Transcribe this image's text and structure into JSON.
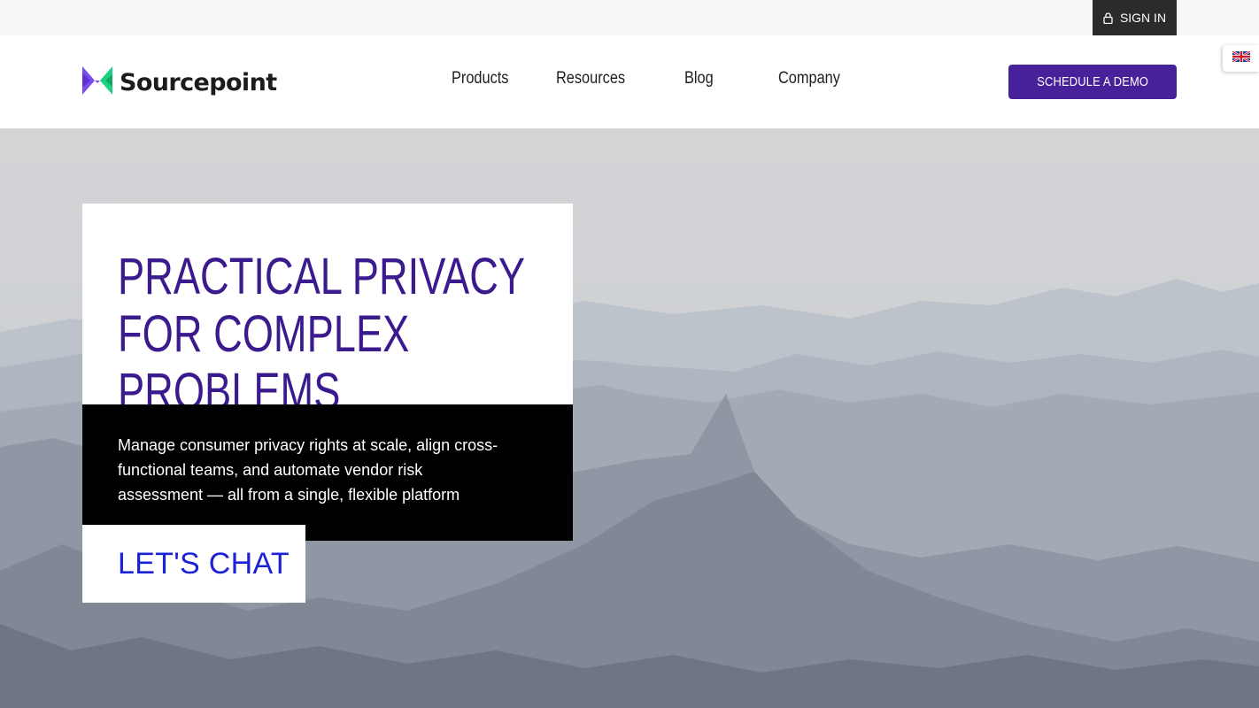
{
  "utility": {
    "sign_in_label": "SIGN IN",
    "sign_in_icon": "lock-icon"
  },
  "header": {
    "logo_text": "Sourcepoint",
    "logo_icon": "sourcepoint-logo-mark",
    "nav": [
      {
        "label": "Products"
      },
      {
        "label": "Resources"
      },
      {
        "label": "Blog"
      },
      {
        "label": "Company"
      }
    ],
    "cta_label": "SCHEDULE A DEMO",
    "language_icon": "uk-flag-icon"
  },
  "hero": {
    "title": "PRACTICAL PRIVACY FOR COMPLEX PROBLEMS",
    "description": "Manage consumer privacy rights at scale, align cross-functional teams, and automate vendor risk assessment — all from a single, flexible platform",
    "cta_label": "LET'S CHAT"
  },
  "colors": {
    "brand_purple": "#46219a",
    "title_purple": "#3b1a8e",
    "link_blue": "#1b22d6",
    "logo_green": "#1fd17e",
    "logo_violet": "#7a4cf0"
  }
}
